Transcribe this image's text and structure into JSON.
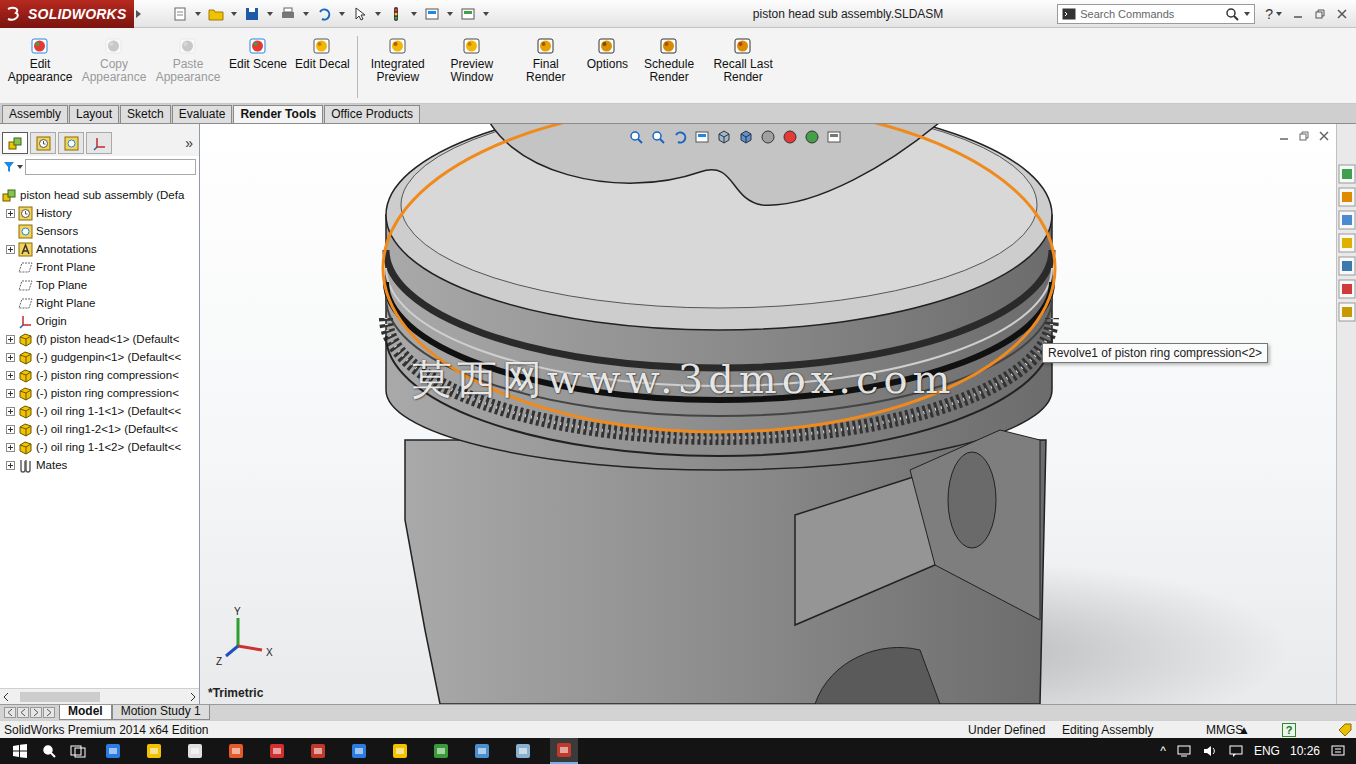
{
  "window": {
    "title": "piston head sub assembly.SLDASM",
    "logo": "SOLIDWORKS"
  },
  "search": {
    "placeholder": "Search Commands"
  },
  "help": "?",
  "ribbon_groups": [
    {
      "buttons": [
        {
          "label": "Edit Appearance",
          "disabled": false
        },
        {
          "label": "Copy Appearance",
          "disabled": true
        },
        {
          "label": "Paste Appearance",
          "disabled": true
        },
        {
          "label": "Edit Scene",
          "disabled": false
        },
        {
          "label": "Edit Decal",
          "disabled": false
        }
      ]
    },
    {
      "buttons": [
        {
          "label": "Integrated Preview",
          "disabled": false
        },
        {
          "label": "Preview Window",
          "disabled": false
        },
        {
          "label": "Final Render",
          "disabled": false
        },
        {
          "label": "Options",
          "disabled": false
        },
        {
          "label": "Schedule Render",
          "disabled": false
        },
        {
          "label": "Recall Last Render",
          "disabled": false
        }
      ]
    }
  ],
  "tabs": [
    {
      "label": "Assembly",
      "selected": false
    },
    {
      "label": "Layout",
      "selected": false
    },
    {
      "label": "Sketch",
      "selected": false
    },
    {
      "label": "Evaluate",
      "selected": false
    },
    {
      "label": "Render Tools",
      "selected": true
    },
    {
      "label": "Office Products",
      "selected": false
    }
  ],
  "panel": {
    "tabs": [
      {
        "selected": true
      },
      {
        "selected": false
      },
      {
        "selected": false
      },
      {
        "selected": false
      }
    ],
    "expand": "»"
  },
  "tree": [
    {
      "label": "piston head sub assembly  (Defa",
      "kind": "assembly",
      "expandable": false
    },
    {
      "label": "History",
      "kind": "history",
      "expandable": true
    },
    {
      "label": "Sensors",
      "kind": "sensors",
      "expandable": false
    },
    {
      "label": "Annotations",
      "kind": "annotations",
      "expandable": true
    },
    {
      "label": "Front Plane",
      "kind": "plane",
      "expandable": false
    },
    {
      "label": "Top Plane",
      "kind": "plane",
      "expandable": false
    },
    {
      "label": "Right Plane",
      "kind": "plane",
      "expandable": false
    },
    {
      "label": "Origin",
      "kind": "origin",
      "expandable": false
    },
    {
      "label": "(f) piston head<1> (Default<",
      "kind": "part",
      "expandable": true
    },
    {
      "label": "(-) gudgenpin<1> (Default<<",
      "kind": "part",
      "expandable": true
    },
    {
      "label": "(-) piston ring compression<",
      "kind": "part",
      "expandable": true
    },
    {
      "label": "(-) piston ring compression<",
      "kind": "part",
      "expandable": true
    },
    {
      "label": "(-) oil ring 1-1<1> (Default<<",
      "kind": "part",
      "expandable": true
    },
    {
      "label": "(-) oil ring1-2<1> (Default<<",
      "kind": "part",
      "expandable": true
    },
    {
      "label": "(-) oil ring 1-1<2> (Default<<",
      "kind": "part",
      "expandable": true
    },
    {
      "label": "Mates",
      "kind": "mates",
      "expandable": true
    }
  ],
  "viewport": {
    "view_name": "*Trimetric",
    "tooltip": "Revolve1 of piston ring compression<2>",
    "watermark": "莫西网www.3dmox.com",
    "axes": [
      "Y",
      "X",
      "Z"
    ]
  },
  "bottom_tabs": [
    {
      "label": "Model",
      "selected": true
    },
    {
      "label": "Motion Study 1",
      "selected": false
    }
  ],
  "status_bar": {
    "edition": "SolidWorks Premium 2014 x64 Edition",
    "state": "Under Defined",
    "mode": "Editing Assembly",
    "units": "MMGS",
    "units_arrow": "▲",
    "help": "?"
  },
  "taskbar": {
    "tray_arrow": "^",
    "language": "ENG",
    "time": "10:26"
  }
}
